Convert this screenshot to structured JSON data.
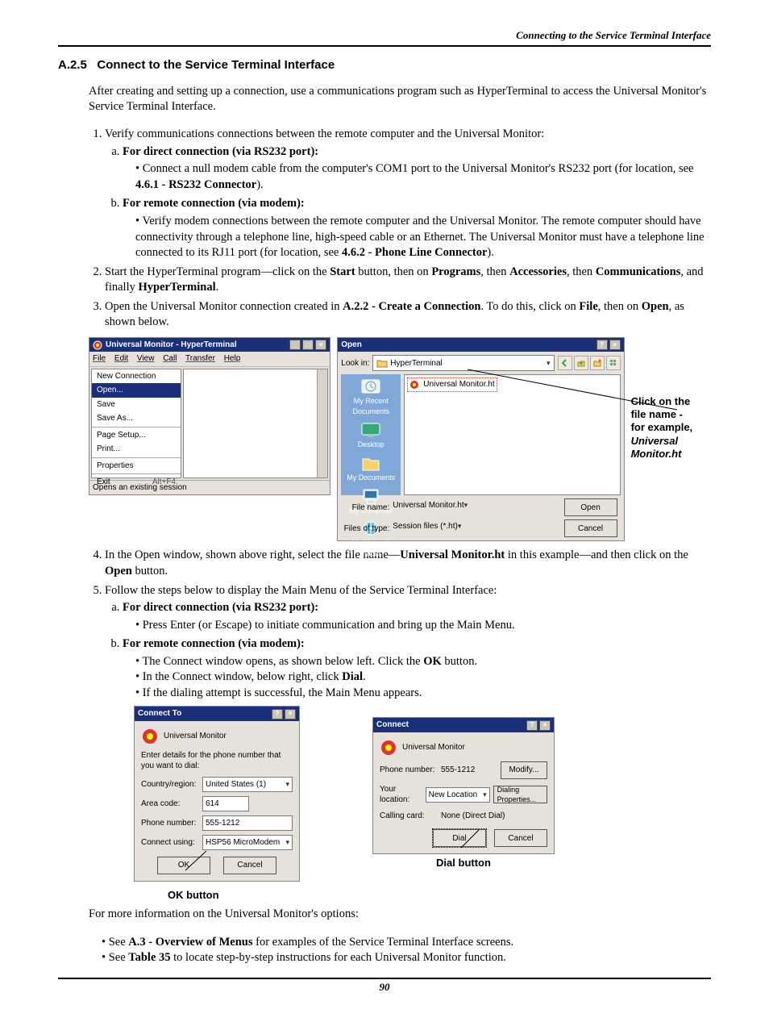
{
  "header": {
    "running": "Connecting to the Service Terminal Interface"
  },
  "section": {
    "num": "A.2.5",
    "title": "Connect to the Service Terminal Interface"
  },
  "intro": "After creating and setting up a connection, use a communications program such as HyperTerminal to access the Universal Monitor's Service Terminal Interface.",
  "step1": "Verify communications connections between the remote computer and the Universal Monitor:",
  "step1a_label": "For direct connection (via RS232 port):",
  "step1a_bullet_pre": "Connect a null modem cable from the computer's COM1 port to the Universal Monitor's RS232 port (for location, see ",
  "step1a_bullet_ref": "4.6.1 - RS232 Connector",
  "step1a_bullet_post": ").",
  "step1b_label": "For remote connection (via modem):",
  "step1b_bullet_pre": "Verify modem connections between the remote computer and the Universal Monitor. The remote computer should have connectivity through a telephone line, high-speed cable or an Ethernet. The Universal Monitor must have a telephone line connected to its RJ11 port (for location, see ",
  "step1b_bullet_ref": "4.6.2 - Phone Line Connector",
  "step1b_bullet_post": ").",
  "step2_pre": "Start the HyperTerminal program—click on the ",
  "step2_b1": "Start",
  "step2_mid1": " button, then on ",
  "step2_b2": "Programs",
  "step2_mid2": ", then ",
  "step2_b3": "Accessories",
  "step2_mid3": ", then ",
  "step2_b4": "Communications",
  "step2_mid4": ", and finally ",
  "step2_b5": "HyperTerminal",
  "step2_end": ".",
  "step3_pre": "Open the Universal Monitor connection created in ",
  "step3_ref": "A.2.2 - Create a Connection",
  "step3_mid": ". To do this, click on ",
  "step3_b1": "File",
  "step3_mid2": ", then on ",
  "step3_b2": "Open",
  "step3_end": ", as shown below.",
  "ht": {
    "title": "Universal Monitor - HyperTerminal",
    "menubar": [
      "File",
      "Edit",
      "View",
      "Call",
      "Transfer",
      "Help"
    ],
    "menu": {
      "new": "New Connection",
      "open": "Open...",
      "save": "Save",
      "saveas": "Save As...",
      "pagesetup": "Page Setup...",
      "print": "Print...",
      "properties": "Properties",
      "exit": "Exit",
      "exit_shortcut": "Alt+F4"
    },
    "status": "Opens an existing session"
  },
  "open": {
    "title": "Open",
    "lookin_label": "Look in:",
    "lookin_value": "HyperTerminal",
    "places": [
      "My Recent Documents",
      "Desktop",
      "My Documents",
      "My Computer",
      "My Network Places"
    ],
    "file_item": "Universal Monitor.ht",
    "filename_label": "File name:",
    "filename_value": "Universal Monitor.ht",
    "filetype_label": "Files of type:",
    "filetype_value": "Session files (*.ht)",
    "open_btn": "Open",
    "cancel_btn": "Cancel"
  },
  "side_caption": {
    "l1": "Click on the",
    "l2": "file name -",
    "l3": "for example,",
    "l4i": "Universal",
    "l5i": "Monitor.ht"
  },
  "step4_pre": "In the Open window, shown above right, select the file name—",
  "step4_b": "Universal Monitor.ht",
  "step4_mid": " in this example—and then click on the ",
  "step4_b2": "Open",
  "step4_end": " button.",
  "step5": "Follow the steps below to display the Main Menu of the Service Terminal Interface:",
  "step5a_label": "For direct connection (via RS232 port):",
  "step5a_bullet": "Press Enter (or Escape) to initiate communication and bring up the Main Menu.",
  "step5b_label": "For remote connection (via modem):",
  "step5b_bul1_pre": "The Connect window opens, as shown below left. Click the ",
  "step5b_bul1_b": "OK",
  "step5b_bul1_end": " button.",
  "step5b_bul2_pre": "In the Connect window, below right, click ",
  "step5b_bul2_b": "Dial",
  "step5b_bul2_end": ".",
  "step5b_bul3": "If the dialing attempt is successful, the Main Menu appears.",
  "connect_to": {
    "title": "Connect To",
    "name": "Universal Monitor",
    "instr": "Enter details for the phone number that you want to dial:",
    "country_lbl": "Country/region:",
    "country_val": "United States (1)",
    "area_lbl": "Area code:",
    "area_val": "614",
    "phone_lbl": "Phone number:",
    "phone_val": "555-1212",
    "connect_lbl": "Connect using:",
    "connect_val": "HSP56 MicroModem",
    "ok": "OK",
    "cancel": "Cancel"
  },
  "connect": {
    "title": "Connect",
    "name": "Universal Monitor",
    "phone_lbl": "Phone number:",
    "phone_val": "555-1212",
    "modify": "Modify...",
    "loc_lbl": "Your location:",
    "loc_val": "New Location",
    "dialprop": "Dialing Properties...",
    "card_lbl": "Calling card:",
    "card_val": "None (Direct Dial)",
    "dial": "Dial",
    "cancel": "Cancel"
  },
  "captions": {
    "ok": "OK button",
    "dial": "Dial button"
  },
  "moreinfo": "For more information on the Universal Monitor's options:",
  "mi1_pre": "See ",
  "mi1_b": "A.3 - Overview of Menus",
  "mi1_end": " for examples of the Service Terminal Interface screens.",
  "mi2_pre": "See ",
  "mi2_b": "Table 35",
  "mi2_end": " to locate step-by-step instructions for each Universal Monitor function.",
  "footer": "90"
}
